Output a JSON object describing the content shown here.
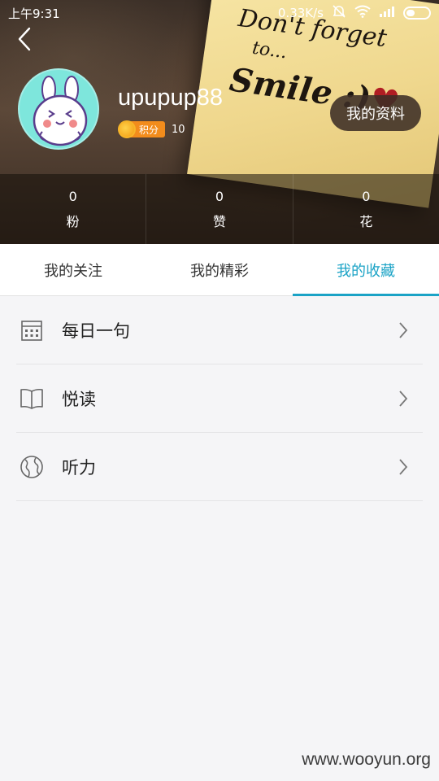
{
  "status_bar": {
    "time": "上午9:31",
    "speed": "0.33K/s"
  },
  "header": {
    "note_lines": [
      "Don't forget",
      "to...",
      "Smile :)"
    ],
    "username": "upupup88",
    "points_label": "积分",
    "points_value": "10",
    "profile_button": "我的资料"
  },
  "stats": [
    {
      "value": "0",
      "label": "粉"
    },
    {
      "value": "0",
      "label": "赞"
    },
    {
      "value": "0",
      "label": "花"
    }
  ],
  "tabs": [
    {
      "label": "我的关注",
      "active": false
    },
    {
      "label": "我的精彩",
      "active": false
    },
    {
      "label": "我的收藏",
      "active": true
    }
  ],
  "list": [
    {
      "label": "每日一句",
      "icon": "calendar-icon"
    },
    {
      "label": "悦读",
      "icon": "book-icon"
    },
    {
      "label": "听力",
      "icon": "globe-icon"
    }
  ],
  "watermark": "www.wooyun.org",
  "colors": {
    "accent": "#1ba3c6",
    "points_badge": "#f28c1c"
  }
}
